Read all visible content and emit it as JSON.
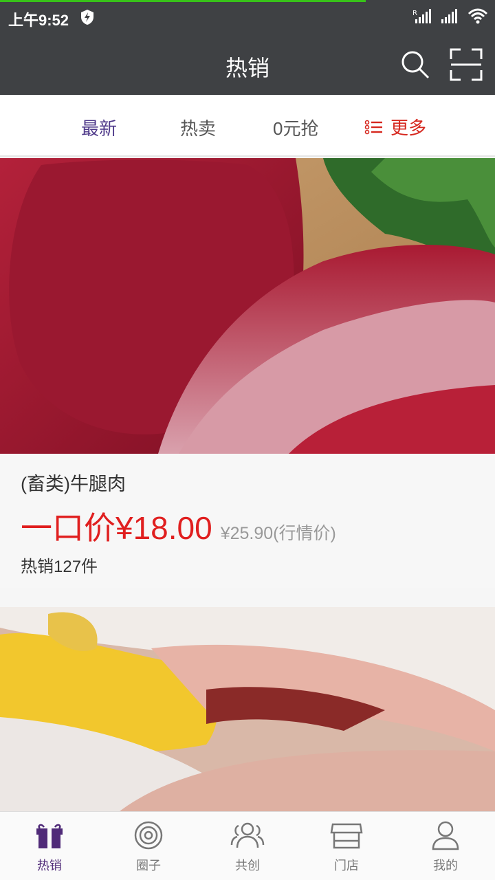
{
  "status_bar": {
    "time": "上午9:52",
    "icons": [
      "shield-bolt-icon",
      "signal-r-icon",
      "signal-icon",
      "wifi-icon"
    ]
  },
  "header": {
    "title": "热销",
    "icons": [
      "search-icon",
      "scan-icon"
    ]
  },
  "tabs": {
    "items": [
      "最新",
      "热卖",
      "0元抢"
    ],
    "active_index": 0,
    "more_label": "更多"
  },
  "products": [
    {
      "name": "(畜类)牛腿肉",
      "price": "一口价¥18.00",
      "market_price": "¥25.90(行情价)",
      "sold": "热销127件"
    }
  ],
  "bottom_nav": {
    "items": [
      {
        "label": "热销",
        "icon": "gift-icon",
        "active": true
      },
      {
        "label": "圈子",
        "icon": "ring-icon",
        "active": false
      },
      {
        "label": "共创",
        "icon": "people-icon",
        "active": false
      },
      {
        "label": "门店",
        "icon": "store-icon",
        "active": false
      },
      {
        "label": "我的",
        "icon": "person-icon",
        "active": false
      }
    ]
  },
  "colors": {
    "header_bg": "#3f4144",
    "accent_purple": "#4f3a8a",
    "price_red": "#e01f1f",
    "more_red": "#d6281f",
    "progress_green": "#38c219"
  }
}
